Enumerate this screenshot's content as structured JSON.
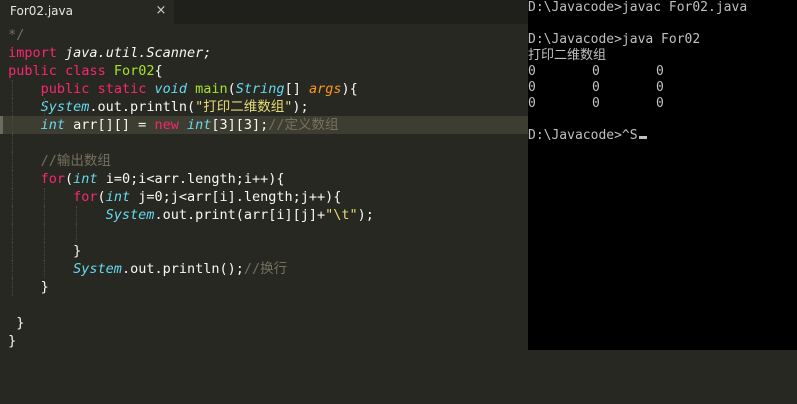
{
  "tab": {
    "title": "For02.java",
    "close": "×"
  },
  "code": {
    "l0": " */",
    "l1_kw": "import",
    "l1_rest": " java.util.Scanner;",
    "l2_kw1": "public",
    "l2_kw2": "class",
    "l2_name": "For02",
    "l2_brace": "{",
    "l3_kw1": "public",
    "l3_kw2": "static",
    "l3_type": "void",
    "l3_fn": "main",
    "l3_p1": "(",
    "l3_ptype": "String",
    "l3_p2": "[] ",
    "l3_param": "args",
    "l3_p3": "){",
    "l4_cls": "System",
    "l4_rest1": ".out.println(",
    "l4_str": "\"打印二维数组\"",
    "l4_rest2": ");",
    "l5_type": "int",
    "l5_rest1": " arr[][] = ",
    "l5_kw": "new",
    "l5_type2": "int",
    "l5_rest2": "[3][3];",
    "l5_cm": "//定义数组",
    "l7_cm": "//输出数组",
    "l8_kw": "for",
    "l8_p": "(",
    "l8_type": "int",
    "l8_rest": " i=0;i<arr.length;i++){",
    "l9_kw": "for",
    "l9_p": "(",
    "l9_type": "int",
    "l9_rest": " j=0;j<arr[i].length;j++){",
    "l10_cls": "System",
    "l10_rest1": ".out.print(arr[i][j]+",
    "l10_str": "\"\\t\"",
    "l10_rest2": ");",
    "l12": "}",
    "l13_cls": "System",
    "l13_rest": ".out.println();",
    "l13_cm": "//换行",
    "l14": "}",
    "l16": "}",
    "l17": "}"
  },
  "console": {
    "line1": "D:\\Javacode>javac For02.java",
    "line2": "",
    "line3": "D:\\Javacode>java For02",
    "line4": "打印二维数组",
    "grid": [
      [
        "0",
        "0",
        "0"
      ],
      [
        "0",
        "0",
        "0"
      ],
      [
        "0",
        "0",
        "0"
      ]
    ],
    "line8": "",
    "prompt": "D:\\Javacode>^S"
  }
}
